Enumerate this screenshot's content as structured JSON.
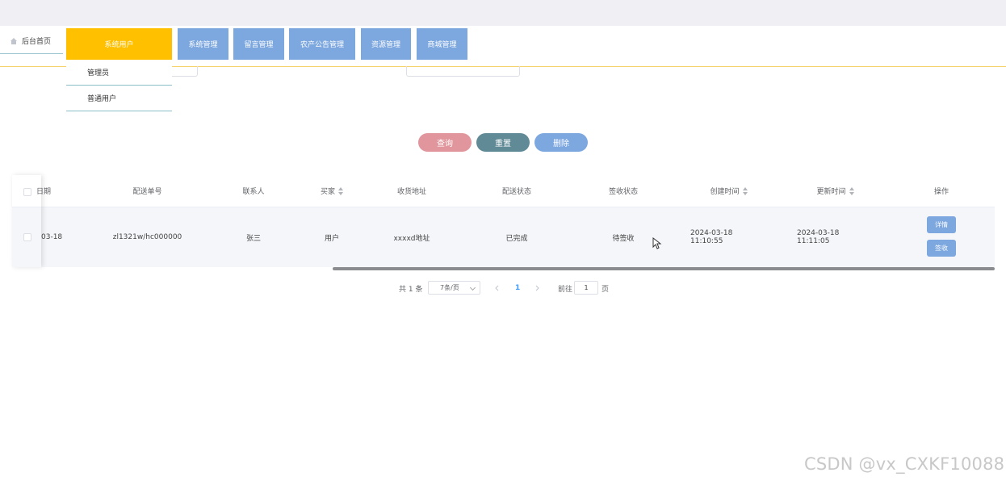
{
  "nav": {
    "home_label": "后台首页",
    "items": [
      {
        "label": "系统用户",
        "active": true
      },
      {
        "label": "系统管理"
      },
      {
        "label": "留言管理"
      },
      {
        "label": "农产公告管理"
      },
      {
        "label": "资源管理"
      },
      {
        "label": "商城管理"
      }
    ],
    "dropdown": [
      "管理员",
      "普通用户"
    ]
  },
  "actions": {
    "query": "查询",
    "reset": "重置",
    "delete": "删除"
  },
  "table": {
    "columns": [
      "日期",
      "配送单号",
      "联系人",
      "买家",
      "收货地址",
      "配送状态",
      "签收状态",
      "创建时间",
      "更新时间",
      "操作"
    ],
    "rows": [
      {
        "date": "03-18",
        "order_no": "zl1321w/hc000000",
        "contact": "张三",
        "buyer": "用户",
        "address": "xxxxd地址",
        "delivery_status": "已完成",
        "sign_status": "待签收",
        "created": "2024-03-18 11:10:55",
        "updated": "2024-03-18 11:11:05",
        "detail_btn": "详情",
        "sign_btn": "签收"
      }
    ]
  },
  "pagination": {
    "total": "共 1 条",
    "page_size": "7条/页",
    "current_page": "1",
    "goto_label": "前往",
    "goto_value": "1",
    "page_suffix": "页"
  },
  "watermark": "CSDN @vx_CXKF10088",
  "colors": {
    "nav_blue": "#7ca7df",
    "nav_active": "#ffc000",
    "query": "#e0969c",
    "reset": "#5f8a96",
    "delete": "#7ca7df"
  }
}
